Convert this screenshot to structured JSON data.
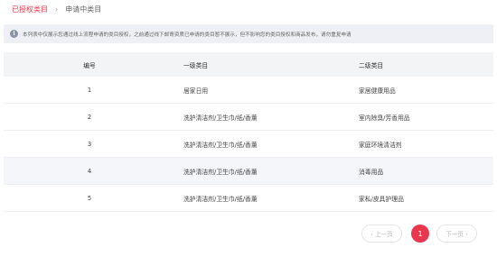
{
  "breadcrumb": {
    "parent": "已授权类目",
    "separator": "›",
    "current": "申请中类目"
  },
  "notice": {
    "icon": "info-icon",
    "text": "本列表中仅展示您通过线上流程申请的类目授权，之前通过线下邮寄资质已申请的类目暂不展示，但不影响您的类目授权和商品发布，请勿重复申请"
  },
  "table": {
    "headers": [
      "编号",
      "一级类目",
      "二级类目"
    ],
    "rows": [
      {
        "no": "1",
        "level1": "居家日用",
        "level2": "家居健康用品"
      },
      {
        "no": "2",
        "level1": "洗护清洁剂/卫生巾/纸/香薰",
        "level2": "室内除臭/芳香用品"
      },
      {
        "no": "3",
        "level1": "洗护清洁剂/卫生巾/纸/香薰",
        "level2": "家庭环境清洁剂"
      },
      {
        "no": "4",
        "level1": "洗护清洁剂/卫生巾/纸/香薰",
        "level2": "消毒用品"
      },
      {
        "no": "5",
        "level1": "洗护清洁剂/卫生巾/纸/香薰",
        "level2": "家私/皮具护理品"
      }
    ]
  },
  "pagination": {
    "prev_label": "‹ 上一页",
    "current_page": "1",
    "next_label": "下一页 ›"
  },
  "colors": {
    "accent": "#e8374f",
    "notice_bg": "#eef0f5",
    "header_bg": "#f3f4f6",
    "alt_row_bg": "#f5f6fa"
  }
}
